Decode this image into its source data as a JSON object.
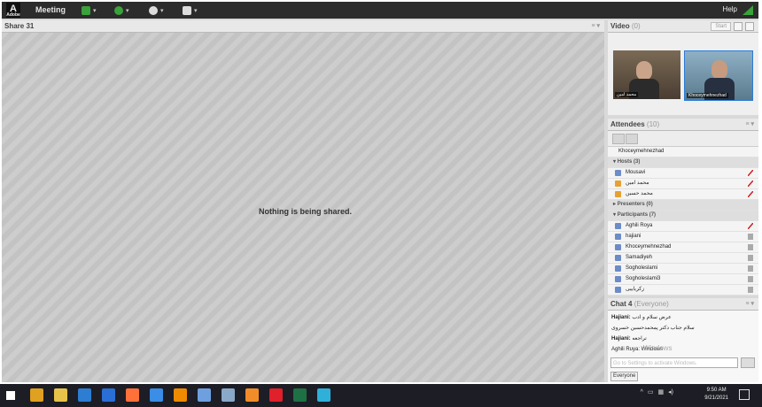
{
  "window": {
    "logo_label": "Adobe",
    "menu_label": "Meeting",
    "help_label": "Help"
  },
  "share_pod": {
    "title": "Share 31",
    "message": "Nothing is being shared."
  },
  "video_pod": {
    "title": "Video",
    "count": "(0)",
    "start_label": "Start",
    "tiles": [
      {
        "name": "محمد امین",
        "tile_color": "#5a4a3a"
      },
      {
        "name": "Khoceymehnezhad",
        "tile_color": "#6f8fa3"
      }
    ]
  },
  "attendees_pod": {
    "title": "Attendees",
    "count": "(10)",
    "top_user": "Khoceymehnezhad",
    "groups": {
      "hosts": "Hosts (3)",
      "presenters": "Presenters (0)",
      "participants": "Participants (7)"
    },
    "hosts": [
      "Mousavi",
      "محمد امین",
      "محمد حسین"
    ],
    "participants": [
      "Aghili Roya",
      "hajiani",
      "Khoceymehnezhad",
      "Samadiyeh",
      "Sogholeslami",
      "Sogholeslami3",
      "زکریاییی"
    ]
  },
  "chat_pod": {
    "title": "Chat 4",
    "scope": "(Everyone)",
    "messages": [
      {
        "sender": "Hajiani:",
        "text": "عرض سلام و ادب"
      },
      {
        "sender": "",
        "text": "سلام جناب دکتر پمحمدحسین خسروی"
      },
      {
        "sender": "Hajiani:",
        "text": "تراجعه"
      },
      {
        "sender": "",
        "text": "Aghili Ruya: Windows"
      }
    ],
    "input_placeholder": "Go to Settings to activate Windows.",
    "recipient": "Everyone",
    "watermark": "Windows"
  },
  "taskbar": {
    "time": "9:50 AM",
    "date": "9/21/2021",
    "apps": [
      {
        "icon": "windows-start-icon",
        "color": "#ffffff"
      },
      {
        "icon": "chrome-icon",
        "color": "#e0a020"
      },
      {
        "icon": "file-explorer-icon",
        "color": "#e8c34a"
      },
      {
        "icon": "store-icon",
        "color": "#2d7dd2"
      },
      {
        "icon": "mail-icon",
        "color": "#2a6fd6"
      },
      {
        "icon": "firefox-icon",
        "color": "#ff7139"
      },
      {
        "icon": "edge-legacy-icon",
        "color": "#3a8ee6"
      },
      {
        "icon": "vlc-icon",
        "color": "#f08a00"
      },
      {
        "icon": "photos-icon",
        "color": "#6ea0e0"
      },
      {
        "icon": "notes-icon",
        "color": "#8aa8c8"
      },
      {
        "icon": "opera-gx-icon",
        "color": "#f28c28"
      },
      {
        "icon": "opera-icon",
        "color": "#e0202a"
      },
      {
        "icon": "excel-icon",
        "color": "#1e7145"
      },
      {
        "icon": "edge-icon",
        "color": "#2fb0d8"
      }
    ]
  }
}
